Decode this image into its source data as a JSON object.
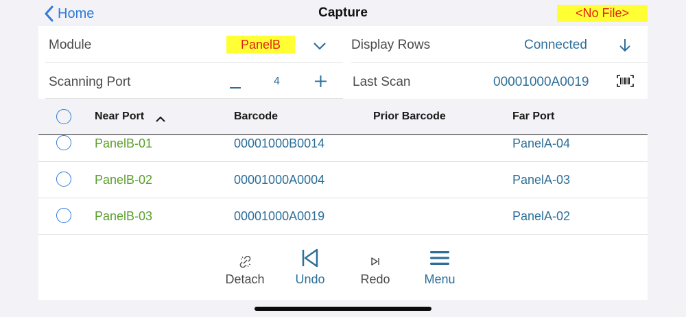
{
  "nav": {
    "back_label": "Home",
    "title": "Capture",
    "file_badge": "<No File>"
  },
  "settings": {
    "module_label": "Module",
    "module_value": "PanelB",
    "display_rows_label": "Display Rows",
    "display_rows_value": "Connected",
    "scanning_port_label": "Scanning Port",
    "scanning_port_value": "4",
    "last_scan_label": "Last Scan",
    "last_scan_value": "00001000A0019"
  },
  "table": {
    "columns": [
      "Near Port",
      "Barcode",
      "Prior Barcode",
      "Far Port"
    ],
    "rows": [
      {
        "near_port": "PanelB-01",
        "barcode": "00001000B0014",
        "prior_barcode": "",
        "far_port": "PanelA-04"
      },
      {
        "near_port": "PanelB-02",
        "barcode": "00001000A0004",
        "prior_barcode": "",
        "far_port": "PanelA-03"
      },
      {
        "near_port": "PanelB-03",
        "barcode": "00001000A0019",
        "prior_barcode": "",
        "far_port": "PanelA-02"
      }
    ]
  },
  "toolbar": {
    "detach": "Detach",
    "undo": "Undo",
    "redo": "Redo",
    "menu": "Menu"
  },
  "icons": {
    "back": "chevron-left-icon",
    "dropdown": "chevron-down-icon",
    "minus": "minus-icon",
    "plus": "plus-icon",
    "download": "arrow-down-icon",
    "barcode": "barcode-icon",
    "sort": "chevron-up-icon",
    "detach": "broken-link-icon",
    "undo": "skip-back-icon",
    "redo": "skip-forward-icon",
    "menu": "hamburger-icon"
  },
  "colors": {
    "accent": "#2f7bd9",
    "value_blue": "#2d6f9a",
    "near_port_green": "#5aa02c",
    "highlight": "#ffff33",
    "highlight_text": "#e0201b"
  }
}
